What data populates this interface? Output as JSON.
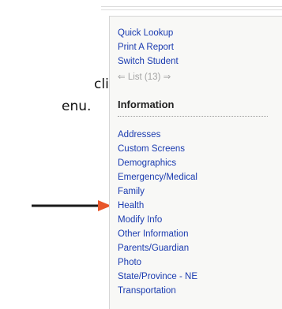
{
  "instruction": {
    "line1": "click",
    "line2": "enu."
  },
  "sidebar": {
    "actions": [
      "Quick Lookup",
      "Print A Report",
      "Switch Student"
    ],
    "list_nav": {
      "label": "List (13)",
      "prev_icon": "left-arrow-icon",
      "next_icon": "right-arrow-icon"
    },
    "section_title": "Information",
    "info_links": [
      "Addresses",
      "Custom Screens",
      "Demographics",
      "Emergency/Medical",
      "Family",
      "Health",
      "Modify Info",
      "Other Information",
      "Parents/Guardian",
      "Photo",
      "State/Province - NE",
      "Transportation"
    ]
  },
  "colors": {
    "link": "#1a3bb0",
    "arrow_pointer": "#1a1a1a",
    "arrow_head": "#e8562a",
    "sidebar_bg": "#f8f8f6",
    "disabled_nav": "#a3a3a3"
  }
}
